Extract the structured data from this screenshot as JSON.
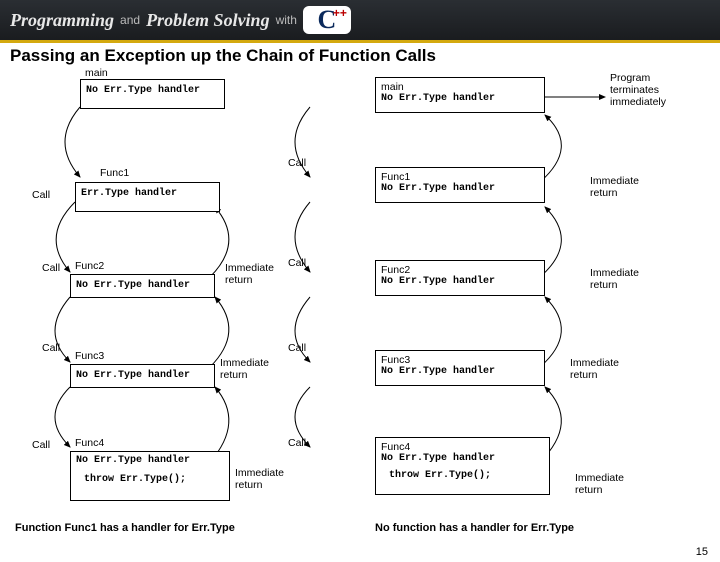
{
  "header": {
    "t1": "Programming",
    "and": "and",
    "t2": "Problem Solving",
    "with": "with",
    "c": "C",
    "pp": "++"
  },
  "title": "Passing an Exception up the Chain of Function Calls",
  "left": {
    "mainLbl": "main",
    "main": "No Err.Type handler",
    "call": "Call",
    "func1Lbl": "Func1",
    "func1": "Err.Type handler",
    "func2Lbl": "Func2",
    "func2": "No Err.Type handler",
    "func3Lbl": "Func3",
    "func3": "No Err.Type handler",
    "func4Lbl": "Func4",
    "func4": "No Err.Type handler",
    "throw": "throw Err.Type();",
    "imm": "Immediate\nreturn",
    "caption": "Function Func1 has a handler for Err.Type"
  },
  "right": {
    "main": "main",
    "mainNo": "No Err.Type handler",
    "prog": "Program\nterminates\nimmediately",
    "func1": "Func1",
    "func1No": "No Err.Type handler",
    "func2": "Func2",
    "func2No": "No Err.Type handler",
    "func3": "Func3",
    "func3No": "No Err.Type handler",
    "func4": "Func4",
    "func4No": "No Err.Type handler",
    "throw": "throw Err.Type();",
    "imm": "Immediate\nreturn",
    "caption": "No function has a handler for Err.Type"
  },
  "call": "Call",
  "slideNo": "15"
}
